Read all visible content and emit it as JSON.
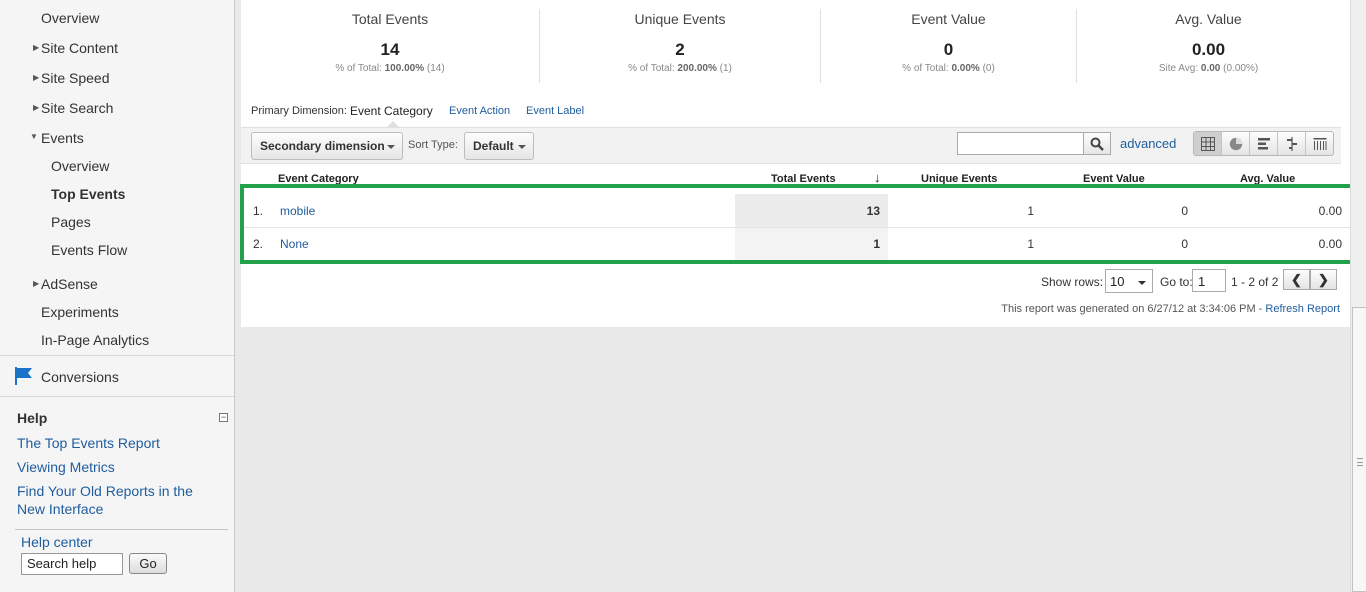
{
  "sidebar": {
    "nav": {
      "overview": "Overview",
      "site_content": "Site Content",
      "site_speed": "Site Speed",
      "site_search": "Site Search",
      "events": "Events",
      "events_overview": "Overview",
      "top_events": "Top Events",
      "pages": "Pages",
      "events_flow": "Events Flow",
      "adsense": "AdSense",
      "experiments": "Experiments",
      "in_page_analytics": "In-Page Analytics",
      "conversions": "Conversions"
    },
    "help": {
      "title": "Help",
      "collapse_glyph": "−",
      "links": [
        "The Top Events Report",
        "Viewing Metrics",
        "Find Your Old Reports in the New Interface"
      ],
      "help_center": "Help center",
      "search_value": "Search help cente",
      "go_label": "Go"
    }
  },
  "summary": [
    {
      "label": "Total Events",
      "value": "14",
      "sub_prefix": "% of Total: ",
      "sub_bold": "100.00%",
      "sub_suffix": " (14)"
    },
    {
      "label": "Unique Events",
      "value": "2",
      "sub_prefix": "% of Total: ",
      "sub_bold": "200.00%",
      "sub_suffix": " (1)"
    },
    {
      "label": "Event Value",
      "value": "0",
      "sub_prefix": "% of Total: ",
      "sub_bold": "0.00%",
      "sub_suffix": " (0)"
    },
    {
      "label": "Avg. Value",
      "value": "0.00",
      "sub_prefix": "Site Avg: ",
      "sub_bold": "0.00",
      "sub_suffix": " (0.00%)"
    }
  ],
  "dimensions": {
    "label": "Primary Dimension:",
    "active": "Event Category",
    "options": [
      "Event Action",
      "Event Label"
    ]
  },
  "toolbar": {
    "secondary_dimension": "Secondary dimension",
    "sort_type_label": "Sort Type:",
    "sort_type_value": "Default",
    "search_value": "",
    "advanced_label": "advanced",
    "view_icons": [
      "table-view-icon",
      "pie-view-icon",
      "performance-view-icon",
      "comparison-view-icon",
      "pivot-view-icon"
    ]
  },
  "table": {
    "columns": [
      "Event Category",
      "Total Events",
      "Unique Events",
      "Event Value",
      "Avg. Value"
    ],
    "sort_glyph": "↓",
    "rows": [
      {
        "index": "1.",
        "category": "mobile",
        "total_events": "13",
        "unique_events": "1",
        "event_value": "0",
        "avg_value": "0.00"
      },
      {
        "index": "2.",
        "category": "None",
        "total_events": "1",
        "unique_events": "1",
        "event_value": "0",
        "avg_value": "0.00"
      }
    ],
    "highlight_color": "#22a04a"
  },
  "pager": {
    "show_rows_label": "Show rows:",
    "show_rows_value": "10",
    "goto_label": "Go to:",
    "goto_value": "1",
    "range": "1 - 2 of 2",
    "prev_glyph": "❮",
    "next_glyph": "❯"
  },
  "footer": {
    "generated_text": "This report was generated on 6/27/12 at 3:34:06 PM - ",
    "refresh_label": "Refresh Report"
  },
  "colors": {
    "link": "#1f5d9e",
    "accent_flag": "#1a73c9"
  }
}
